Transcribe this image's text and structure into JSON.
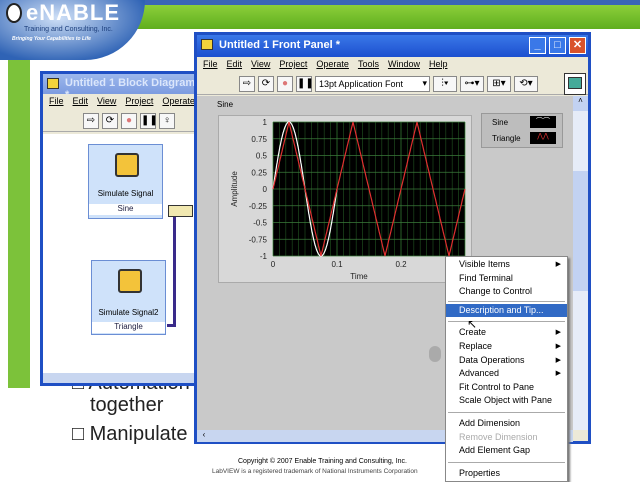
{
  "logo": {
    "name": "eNABLE",
    "subtitle": "Training and Consulting, Inc.",
    "tagline": "Bringing Your Capabilities to Life"
  },
  "slide": {
    "bullets": [
      "Automation",
      "together",
      "Manipulate"
    ],
    "copyright": "Copyright © 2007 Enable Training and Consulting, Inc.",
    "trademark": "LabVIEW is a registered trademark of National Instruments Corporation"
  },
  "block_diagram": {
    "title": "Untitled 1 Block Diagram *",
    "menu": [
      "File",
      "Edit",
      "View",
      "Project",
      "Operate"
    ],
    "nodes": [
      {
        "label": "Simulate Signal",
        "output": "Sine"
      },
      {
        "label": "Simulate Signal2",
        "output": "Triangle"
      }
    ]
  },
  "front_panel": {
    "title": "Untitled 1 Front Panel *",
    "menu": [
      "File",
      "Edit",
      "View",
      "Project",
      "Operate",
      "Tools",
      "Window",
      "Help"
    ],
    "font_select": "13pt Application Font",
    "graph_label": "Sine",
    "legend": [
      "Sine",
      "Triangle"
    ]
  },
  "context_menu": {
    "items": [
      {
        "label": "Visible Items",
        "submenu": true
      },
      {
        "label": "Find Terminal"
      },
      {
        "label": "Change to Control"
      },
      {
        "label": "Description and Tip...",
        "highlighted": true
      },
      {
        "label": "Create",
        "submenu": true
      },
      {
        "label": "Replace",
        "submenu": true
      },
      {
        "label": "Data Operations",
        "submenu": true
      },
      {
        "label": "Advanced",
        "submenu": true
      },
      {
        "label": "Fit Control to Pane"
      },
      {
        "label": "Scale Object with Pane"
      },
      {
        "label": "Add Dimension"
      },
      {
        "label": "Remove Dimension",
        "disabled": true
      },
      {
        "label": "Add Element Gap"
      },
      {
        "label": "Properties"
      }
    ]
  },
  "chart_data": {
    "type": "line",
    "title": "Sine",
    "xlabel": "Time",
    "ylabel": "Amplitude",
    "xlim": [
      0,
      0.3
    ],
    "ylim": [
      -1,
      1
    ],
    "xticks": [
      "0",
      "0.1",
      "0.2"
    ],
    "yticks": [
      "1",
      "0.75",
      "0.5",
      "0.25",
      "0",
      "-0.25",
      "-0.5",
      "-0.75",
      "-1"
    ],
    "series": [
      {
        "name": "Sine",
        "color": "#ffffff",
        "shape": "sine",
        "frequency_hz": 10,
        "amplitude": 1,
        "x_range": [
          0,
          0.1
        ]
      },
      {
        "name": "Triangle",
        "color": "#e03030",
        "shape": "triangle",
        "frequency_hz": 10,
        "amplitude": 1,
        "x_range": [
          0,
          0.3
        ]
      }
    ],
    "grid": true,
    "legend": "top-right"
  }
}
